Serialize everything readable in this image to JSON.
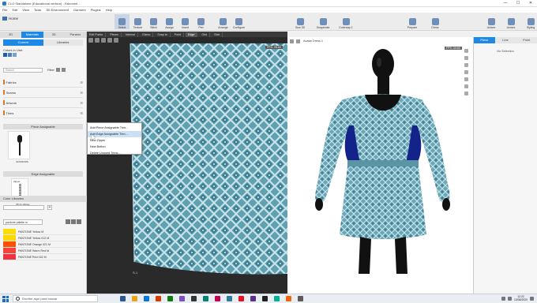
{
  "window": {
    "title": "CLO Standalone (Educational version) - Falconeri...",
    "controls": [
      "—",
      "☐",
      "✕"
    ]
  },
  "menu": [
    "File",
    "Edit",
    "View",
    "Tools",
    "3D Environment",
    "Garment",
    "Plugins",
    "Help"
  ],
  "toolbar": {
    "home_label": "Home",
    "tools": [
      "Select",
      "Texture",
      "Stitch",
      "Assign",
      "Insert",
      "Pen",
      "Arrange",
      "Configure"
    ],
    "mid": [
      "Size 3D",
      "Snapshots",
      "Colorway 1"
    ],
    "right": [
      "Prepare",
      "Dress"
    ],
    "far": [
      "Unisex",
      "Unisex",
      "Styling"
    ]
  },
  "left_panel": {
    "tabs": [
      "2D",
      "Materials",
      "3D",
      "Params"
    ],
    "active_tab": "Materials",
    "subtabs": [
      "Current",
      "Libraries"
    ],
    "colors_label": "Colors in Use:",
    "swatches": [
      "#1f5fa8",
      "#4a7fbf",
      "#7a9fc9"
    ],
    "search_placeholder": "Search",
    "filter_label": "Filter",
    "sections": [
      "Fabrics",
      "Seams",
      "Artwork",
      "Trims"
    ],
    "piece_trims_title": "Piece Assignable",
    "piece_trim_name": "SCISSORS",
    "edge_trims_title": "Edge Assignable",
    "edge_trim_label": "Zipper",
    "edge_trim_name": "#5 Cn Zipper",
    "color_libraries_title": "Color Libraries",
    "pantone_select": "pantone palette m",
    "pantone": [
      {
        "name": "PANTONE Yellow M",
        "color": "#fedd00"
      },
      {
        "name": "PANTONE Yellow 012 M",
        "color": "#ffd700"
      },
      {
        "name": "PANTONE Orange 021 M",
        "color": "#fe5000"
      },
      {
        "name": "PANTONE Warm Red M",
        "color": "#f9423a"
      },
      {
        "name": "PANTONE Red 032 M",
        "color": "#ef3340"
      }
    ]
  },
  "context_menu": {
    "items": [
      "Add Piece Assignable Trim...",
      "Add Edge Assignable Trim...",
      "New Zipper",
      "New Button",
      "Delete Unused Trims..."
    ],
    "highlighted_index": 1
  },
  "window2d": {
    "buttons": [
      "Edit Points",
      "Pieces",
      "Internal",
      "Gizmo",
      "Snap to",
      "Point",
      "Edge",
      "Grid",
      "Side"
    ],
    "active_button": "Edge",
    "fps": "FPS: 28.48",
    "label": "S-1"
  },
  "window3d": {
    "avatar_name": "Avatar Dress 1",
    "fps": "FPS: 34.65"
  },
  "right_panel": {
    "tabs": [
      "Piece",
      "Line",
      "Point"
    ],
    "active_tab": "Piece",
    "no_selection": "No Selection"
  },
  "taskbar": {
    "search_placeholder": "Escribe aquí para buscar",
    "time": "12:22",
    "date": "13/06/2020",
    "app_colors": [
      "#2b5797",
      "#e8a317",
      "#0078d7",
      "#d83b01",
      "#107c10",
      "#7f4fc1",
      "#333333",
      "#008272",
      "#c30052",
      "#2d7d9a",
      "#e81123",
      "#5c2d91",
      "#1e1e1e",
      "#00b294",
      "#f7630c",
      "#5a5a5a"
    ]
  },
  "colors": {
    "accent": "#1e88e5",
    "fabric": "#5fa0b1",
    "mannequin": "#111111",
    "dress_accent": "#13238a"
  }
}
